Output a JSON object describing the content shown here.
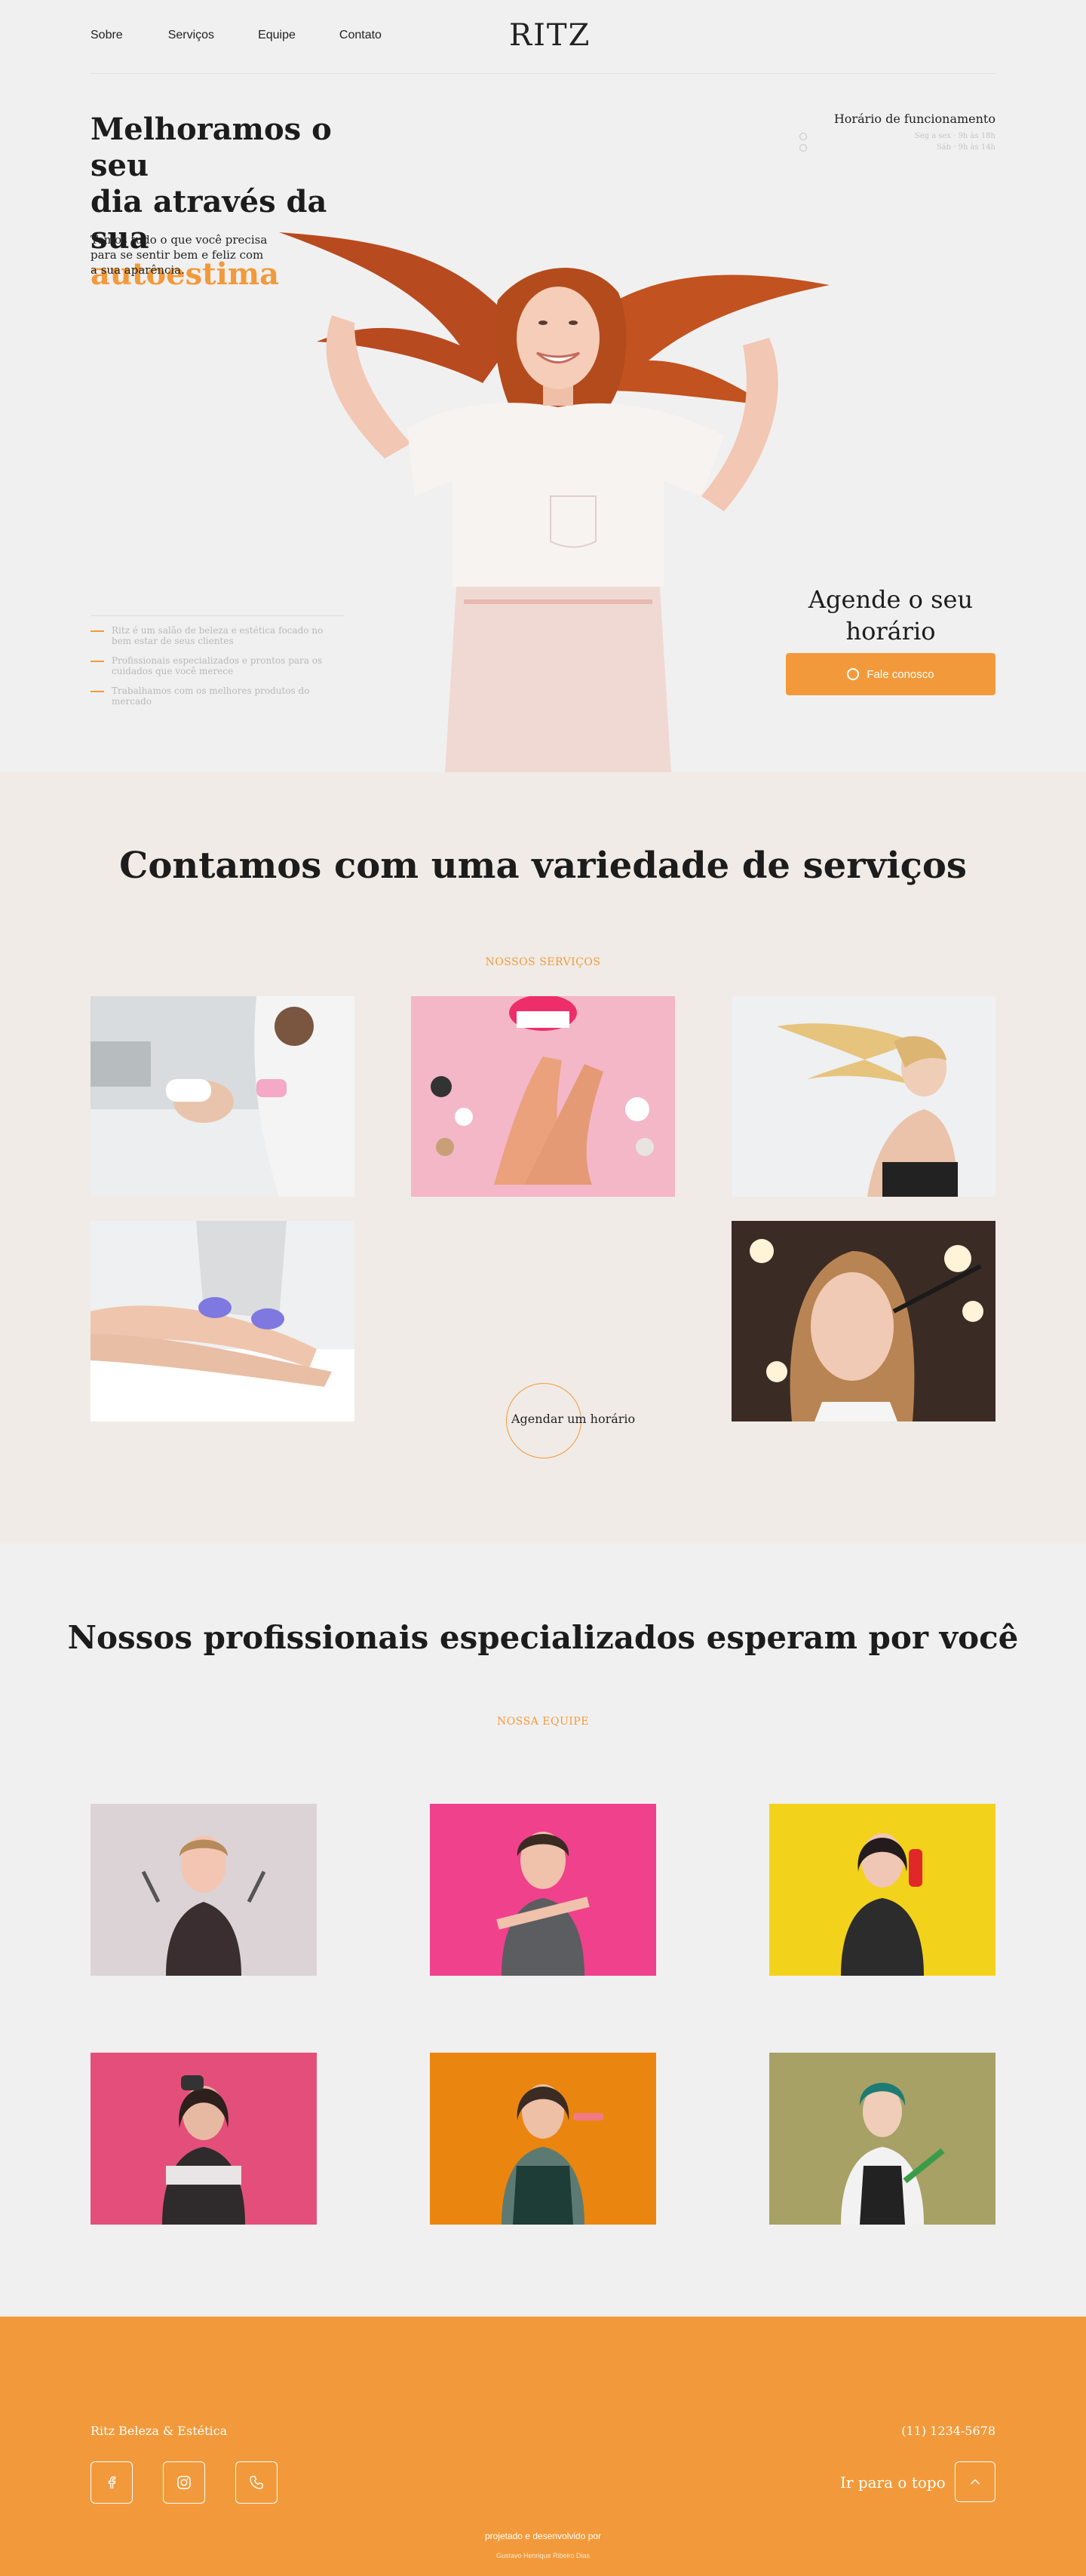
{
  "nav": {
    "links": [
      "Sobre",
      "Serviços",
      "Equipe",
      "Contato"
    ],
    "logo": "RITZ"
  },
  "hero": {
    "title_line1": "Melhoramos o seu",
    "title_line2": "dia através da sua",
    "title_accent": "autoestima",
    "subtitle": "Temos tudo o que você precisa para se sentir bem e feliz com a sua aparência.",
    "features": [
      "Ritz é um salão de beleza e estética focado no bem estar de seus clientes",
      "Profissionais especializados e prontos para os cuidados que você merece",
      "Trabalhamos com os melhores produtos do mercado"
    ],
    "hours_title": "Horário de funcionamento",
    "hours": [
      "Seg a sex · 9h às 18h",
      "Sáb · 9h às 14h"
    ],
    "schedule_title": "Agende o seu horário",
    "whatsapp_label": "Fale conosco"
  },
  "services": {
    "title": "Contamos com uma variedade de serviços",
    "kicker": "NOSSOS SERVIÇOS",
    "cta": "Agendar um horário"
  },
  "team": {
    "title": "Nossos profissionais especializados esperam por você",
    "kicker": "NOSSA EQUIPE"
  },
  "footer": {
    "brand": "Ritz Beleza & Estética",
    "phone": "(11) 1234-5678",
    "to_top": "Ir para o topo",
    "credit": "projetado e desenvolvido por",
    "author": "Gustavo Henrique Ribeiro Dias"
  },
  "colors": {
    "accent": "#f29a3b",
    "background": "#f1f0f0",
    "services_bg": "#f0ebe6",
    "team_backgrounds": [
      "#dcd3d7",
      "#f0418c",
      "#f3d21b",
      "#e34f7a",
      "#ea8610",
      "#a7a165"
    ]
  }
}
